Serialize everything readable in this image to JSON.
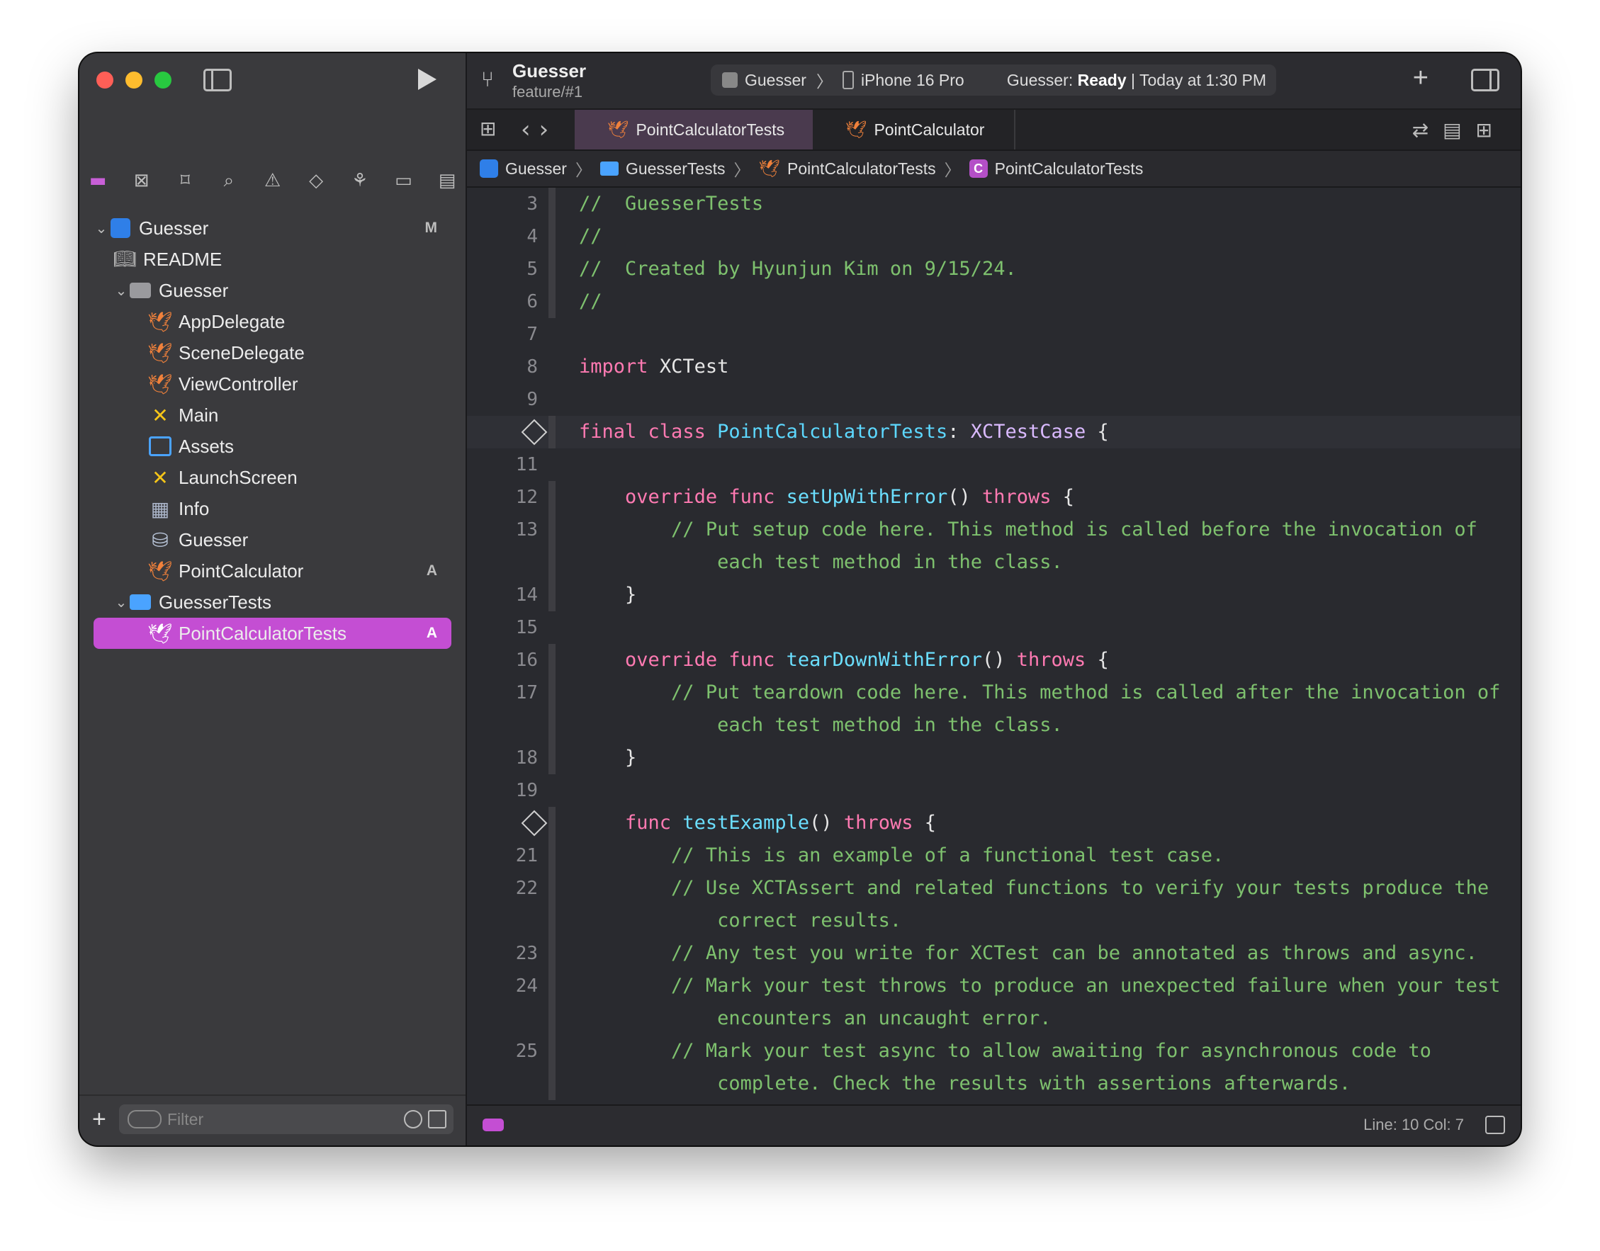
{
  "sidebar": {
    "tree": [
      {
        "label": "Guesser",
        "badge": "M",
        "kind": "project"
      },
      {
        "label": "README",
        "badge": "",
        "kind": "readme"
      },
      {
        "label": "Guesser",
        "badge": "",
        "kind": "folder"
      },
      {
        "label": "AppDelegate",
        "badge": "",
        "kind": "swift"
      },
      {
        "label": "SceneDelegate",
        "badge": "",
        "kind": "swift"
      },
      {
        "label": "ViewController",
        "badge": "",
        "kind": "swift"
      },
      {
        "label": "Main",
        "badge": "",
        "kind": "storyboard"
      },
      {
        "label": "Assets",
        "badge": "",
        "kind": "assets"
      },
      {
        "label": "LaunchScreen",
        "badge": "",
        "kind": "storyboard"
      },
      {
        "label": "Info",
        "badge": "",
        "kind": "plist"
      },
      {
        "label": "Guesser",
        "badge": "",
        "kind": "datamodel"
      },
      {
        "label": "PointCalculator",
        "badge": "A",
        "kind": "swift"
      },
      {
        "label": "GuesserTests",
        "badge": "",
        "kind": "folder-blue"
      },
      {
        "label": "PointCalculatorTests",
        "badge": "A",
        "kind": "swift"
      }
    ],
    "filter_placeholder": "Filter"
  },
  "toolbar": {
    "project_name": "Guesser",
    "branch": "feature/#1",
    "scheme": "Guesser",
    "device": "iPhone 16 Pro",
    "status_prefix": "Guesser: ",
    "status_state": "Ready",
    "status_time": " | Today at 1:30 PM"
  },
  "tabs": [
    {
      "label": "PointCalculatorTests",
      "active": true
    },
    {
      "label": "PointCalculator",
      "active": false
    }
  ],
  "breadcrumb": {
    "project": "Guesser",
    "folder": "GuesserTests",
    "file": "PointCalculatorTests",
    "symbol_icon": "C",
    "symbol": "PointCalculatorTests"
  },
  "code": {
    "l3": "3",
    "l4": "4",
    "l5": "5",
    "l6": "6",
    "l7": "7",
    "l8": "8",
    "l9": "9",
    "l11": "11",
    "l12": "12",
    "l13": "13",
    "l14": "14",
    "l15": "15",
    "l16": "16",
    "l17": "17",
    "l18": "18",
    "l19": "19",
    "l21": "21",
    "l22": "22",
    "l23": "23",
    "l24": "24",
    "l25": "25",
    "c3": "//  GuesserTests",
    "c4": "//",
    "c5": "//  Created by Hyunjun Kim on 9/15/24.",
    "c6": "//",
    "c13a": "// Put setup code here. This method is called before the invocation of",
    "c13b": "each test method in the class.",
    "c17a": "// Put teardown code here. This method is called after the invocation of",
    "c17b": "each test method in the class.",
    "c21": "// This is an example of a functional test case.",
    "c22a": "// Use XCTAssert and related functions to verify your tests produce the",
    "c22b": "correct results.",
    "c23": "// Any test you write for XCTest can be annotated as throws and async.",
    "c24a": "// Mark your test throws to produce an unexpected failure when your test",
    "c24b": "encounters an uncaught error.",
    "c25a": "// Mark your test async to allow awaiting for asynchronous code to",
    "c25b": "complete. Check the results with assertions afterwards.",
    "kw_import": "import",
    "ty_xctest": "XCTest",
    "kw_final": "final",
    "kw_class": "class",
    "cls_name": "PointCalculatorTests",
    "ty_xctestcase": "XCTestCase",
    "kw_override": "override",
    "kw_func": "func",
    "fn_setup": "setUpWithError",
    "fn_teardown": "tearDownWithError",
    "fn_test": "testExample",
    "kw_throws": "throws"
  },
  "status": {
    "position": "Line: 10  Col: 7"
  },
  "colors": {
    "accent": "#c44ed3",
    "keyword": "#ff7ab2",
    "comment": "#7ec16e",
    "function": "#6bdfff"
  }
}
